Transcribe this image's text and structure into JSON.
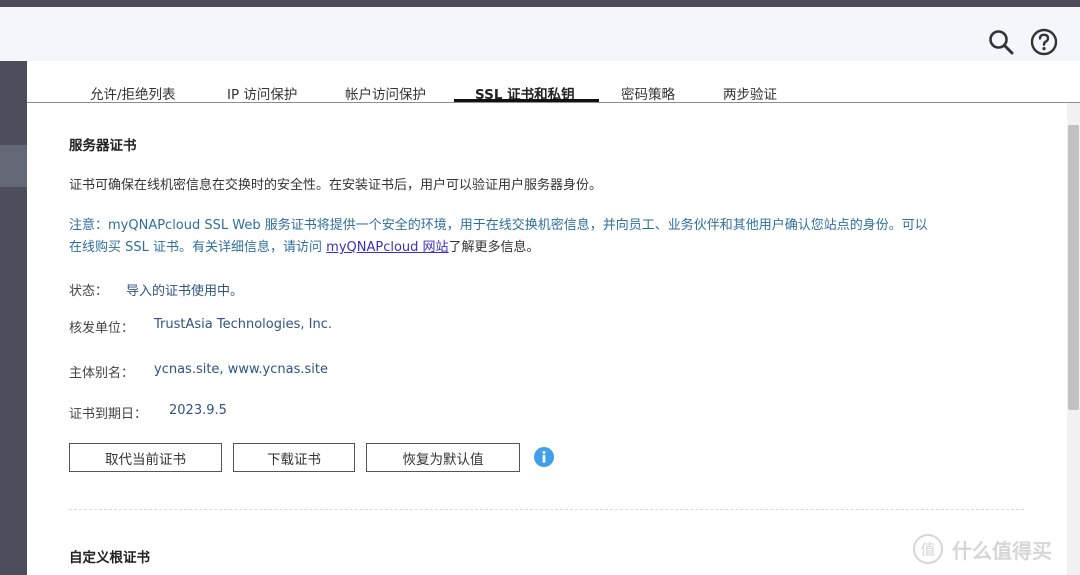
{
  "tabs": [
    {
      "label": "允许/拒绝列表"
    },
    {
      "label": "IP 访问保护"
    },
    {
      "label": "帐户访问保护"
    },
    {
      "label": "SSL 证书和私钥"
    },
    {
      "label": "密码策略"
    },
    {
      "label": "两步验证"
    }
  ],
  "active_tab": "SSL 证书和私钥",
  "server_cert": {
    "title": "服务器证书",
    "description": "证书可确保在线机密信息在交换时的安全性。在安装证书后，用户可以验证用户服务器身份。",
    "note_line1": "注意：myQNAPcloud SSL Web 服务证书将提供一个安全的环境，用于在线交换机密信息，并向员工、业务伙伴和其他用户确认您站点的身份。可以",
    "note_line2_pre": "在线购买 SSL 证书。有关详细信息，请访问 ",
    "note_link": "myQNAPcloud 网站",
    "note_line2_post": "了解更多信息。",
    "fields": {
      "status_label": "状态：",
      "status_value": "导入的证书使用中。",
      "issuer_label": "核发单位：",
      "issuer_value": "TrustAsia Technologies, Inc.",
      "alias_label": "主体别名：",
      "alias_value": "ycnas.site, www.ycnas.site",
      "expiry_label": "证书到期日：",
      "expiry_value": "2023.9.5"
    },
    "buttons": {
      "replace": "取代当前证书",
      "download": "下载证书",
      "restore": "恢复为默认值"
    }
  },
  "custom_root": {
    "title": "自定义根证书"
  },
  "watermark": {
    "text": "什么值得买",
    "logo_char": "值"
  },
  "header_icons": [
    "search-icon",
    "help-icon"
  ],
  "colors": {
    "topbar": "#4b4e5a",
    "header_bg": "#f4f6fb",
    "left_nav": "#4c4e5b",
    "note_text": "#2f6f9f",
    "value_text": "#2f5383",
    "link": "#3b2fc9",
    "info_icon": "#3f9fe8"
  }
}
